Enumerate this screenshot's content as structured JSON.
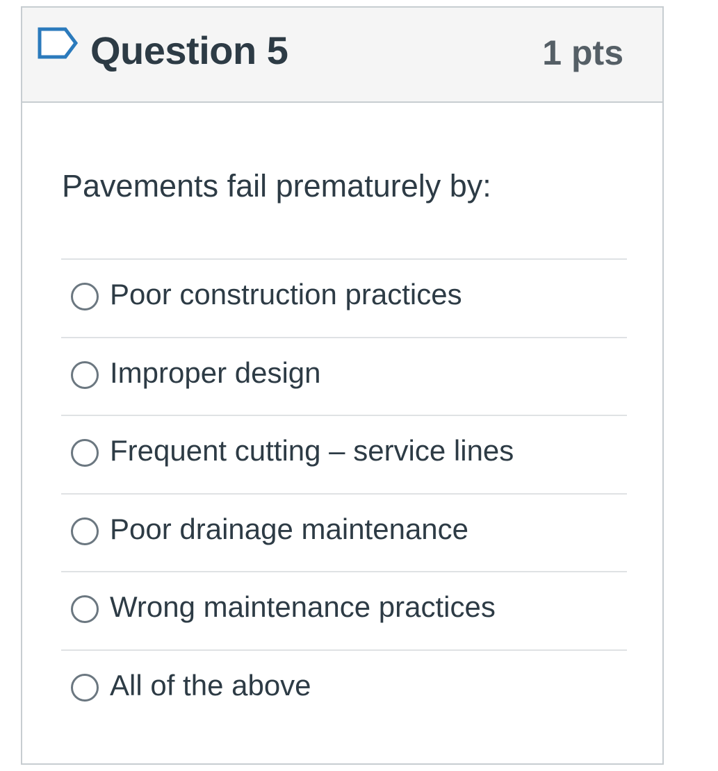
{
  "question": {
    "title": "Question 5",
    "points": "1 pts",
    "flag_icon": "flag-outline-icon",
    "prompt": "Pavements fail prematurely by:",
    "selected": null,
    "answers": [
      {
        "label": "Poor construction practices"
      },
      {
        "label": "Improper design"
      },
      {
        "label": "Frequent cutting – service lines"
      },
      {
        "label": "Poor drainage maintenance"
      },
      {
        "label": "Wrong maintenance practices"
      },
      {
        "label": "All of the above"
      }
    ]
  },
  "colors": {
    "text": "#2d3b45",
    "points_text": "#555f66",
    "header_bg": "#f5f5f5",
    "border": "#c7cdd1",
    "flag_stroke": "#2b7abc"
  }
}
